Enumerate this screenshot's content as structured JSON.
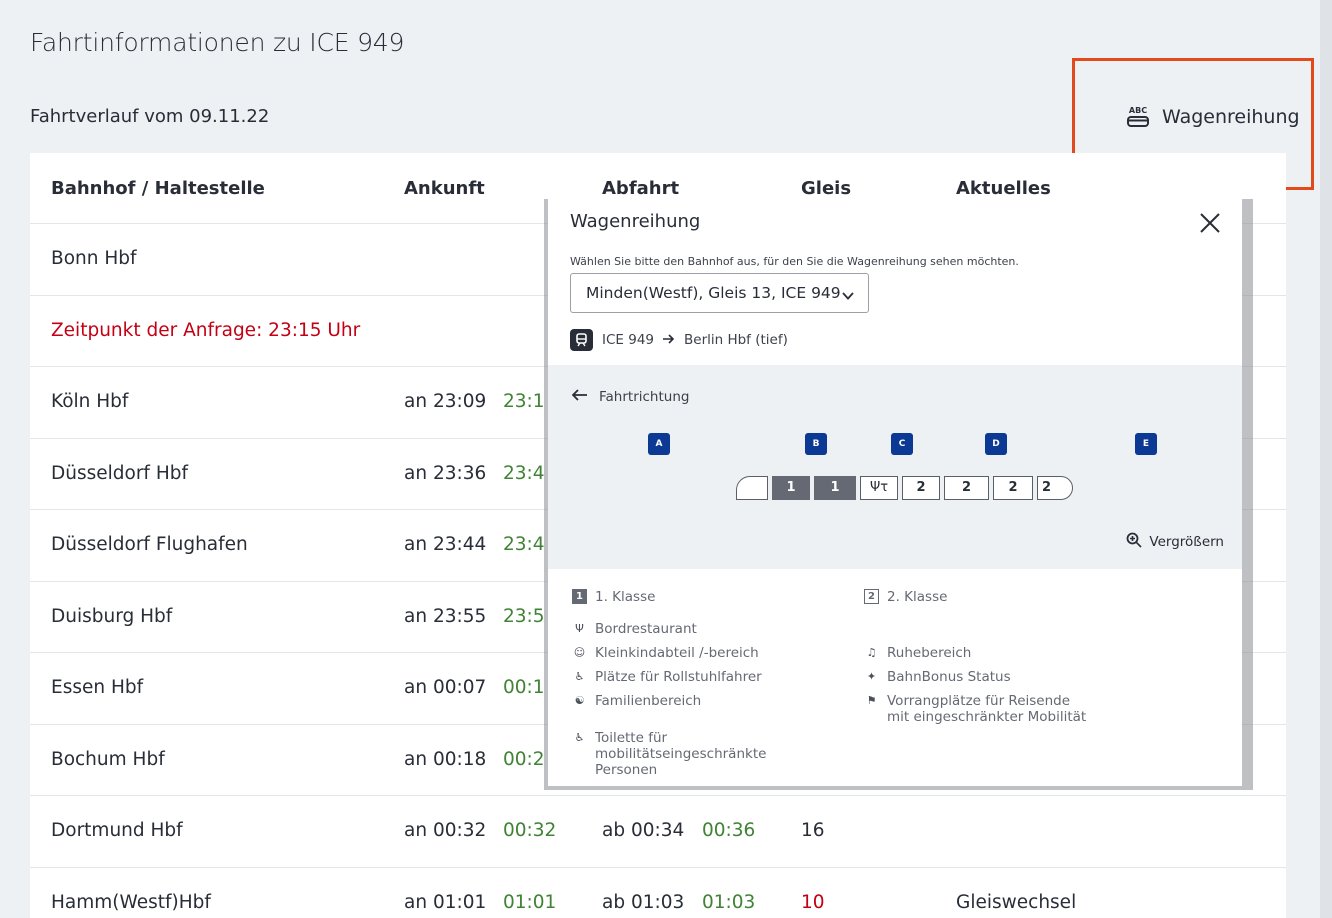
{
  "page": {
    "title": "Fahrtinformationen zu ICE 949",
    "subtitle": "Fahrtverlauf vom 09.11.22",
    "wagon_link": "Wagenreihung",
    "wagon_icon": "train-coach-icon"
  },
  "table": {
    "headers": {
      "station": "Bahnhof / Haltestelle",
      "arrival": "Ankunft",
      "departure": "Abfahrt",
      "track": "Gleis",
      "info": "Aktuelles"
    },
    "rows": [
      {
        "station": "Bonn Hbf",
        "arr": "",
        "arr_rt": "",
        "dep": "",
        "dep_rt": "",
        "track": "",
        "info": ""
      },
      {
        "station": "Zeitpunkt der Anfrage: 23:15 Uhr",
        "query": true
      },
      {
        "station": "Köln Hbf",
        "arr": "an 23:09",
        "arr_rt": "23:1",
        "dep": "",
        "dep_rt": "",
        "track": "",
        "info": ""
      },
      {
        "station": "Düsseldorf Hbf",
        "arr": "an 23:36",
        "arr_rt": "23:4",
        "dep": "",
        "dep_rt": "",
        "track": "",
        "info": ""
      },
      {
        "station": "Düsseldorf Flughafen",
        "arr": "an 23:44",
        "arr_rt": "23:4",
        "dep": "",
        "dep_rt": "",
        "track": "",
        "info": ""
      },
      {
        "station": "Duisburg Hbf",
        "arr": "an 23:55",
        "arr_rt": "23:5",
        "dep": "",
        "dep_rt": "",
        "track": "",
        "info": ""
      },
      {
        "station": "Essen Hbf",
        "arr": "an 00:07",
        "arr_rt": "00:1",
        "dep": "",
        "dep_rt": "",
        "track": "",
        "info": ""
      },
      {
        "station": "Bochum Hbf",
        "arr": "an 00:18",
        "arr_rt": "00:2",
        "dep": "",
        "dep_rt": "",
        "track": "",
        "info": ""
      },
      {
        "station": "Dortmund Hbf",
        "arr": "an 00:32",
        "arr_rt": "00:32",
        "dep": "ab 00:34",
        "dep_rt": "00:36",
        "track": "16",
        "info": ""
      },
      {
        "station": "Hamm(Westf)Hbf",
        "arr": "an 01:01",
        "arr_rt": "01:01",
        "dep": "ab 01:03",
        "dep_rt": "01:03",
        "track": "10",
        "track_changed": true,
        "info": "Gleiswechsel"
      }
    ]
  },
  "modal": {
    "title": "Wagenreihung",
    "hint": "Wählen Sie bitte den Bahnhof aus, für den Sie die Wagenreihung sehen möchten.",
    "selected_station": "Minden(Westf), Gleis 13, ICE 949",
    "train": "ICE 949",
    "destination": "Berlin Hbf (tief)",
    "direction_label": "Fahrtrichtung",
    "sectors": [
      "A",
      "B",
      "C",
      "D",
      "E"
    ],
    "coaches": [
      {
        "label": "",
        "type": "head"
      },
      {
        "label": "1",
        "type": "first"
      },
      {
        "label": "1",
        "type": "first"
      },
      {
        "label": "Ψτ",
        "type": "restaurant"
      },
      {
        "label": "2",
        "type": "second"
      },
      {
        "label": "2",
        "type": "second"
      },
      {
        "label": "2",
        "type": "second"
      },
      {
        "label": "2",
        "type": "end"
      }
    ],
    "zoom_label": "Vergrößern",
    "legend": {
      "first_class": "1. Klasse",
      "second_class": "2. Klasse",
      "restaurant": "Bordrestaurant",
      "toddler": "Kleinkindabteil /-bereich",
      "quiet": "Ruhebereich",
      "wheelchair": "Plätze für Rollstuhlfahrer",
      "bonus": "BahnBonus Status",
      "family": "Familienbereich",
      "priority": "Vorrangplätze für Reisende mit eingeschränkter Mobilität",
      "toilet": "Toilette für mobilitätseingeschränkte Personen",
      "first_num": "1",
      "second_num": "2"
    }
  },
  "colors": {
    "accent_red": "#c50014",
    "realtime_green": "#408335",
    "sector_blue": "#0c3993",
    "highlight_orange": "#e24a1b"
  }
}
